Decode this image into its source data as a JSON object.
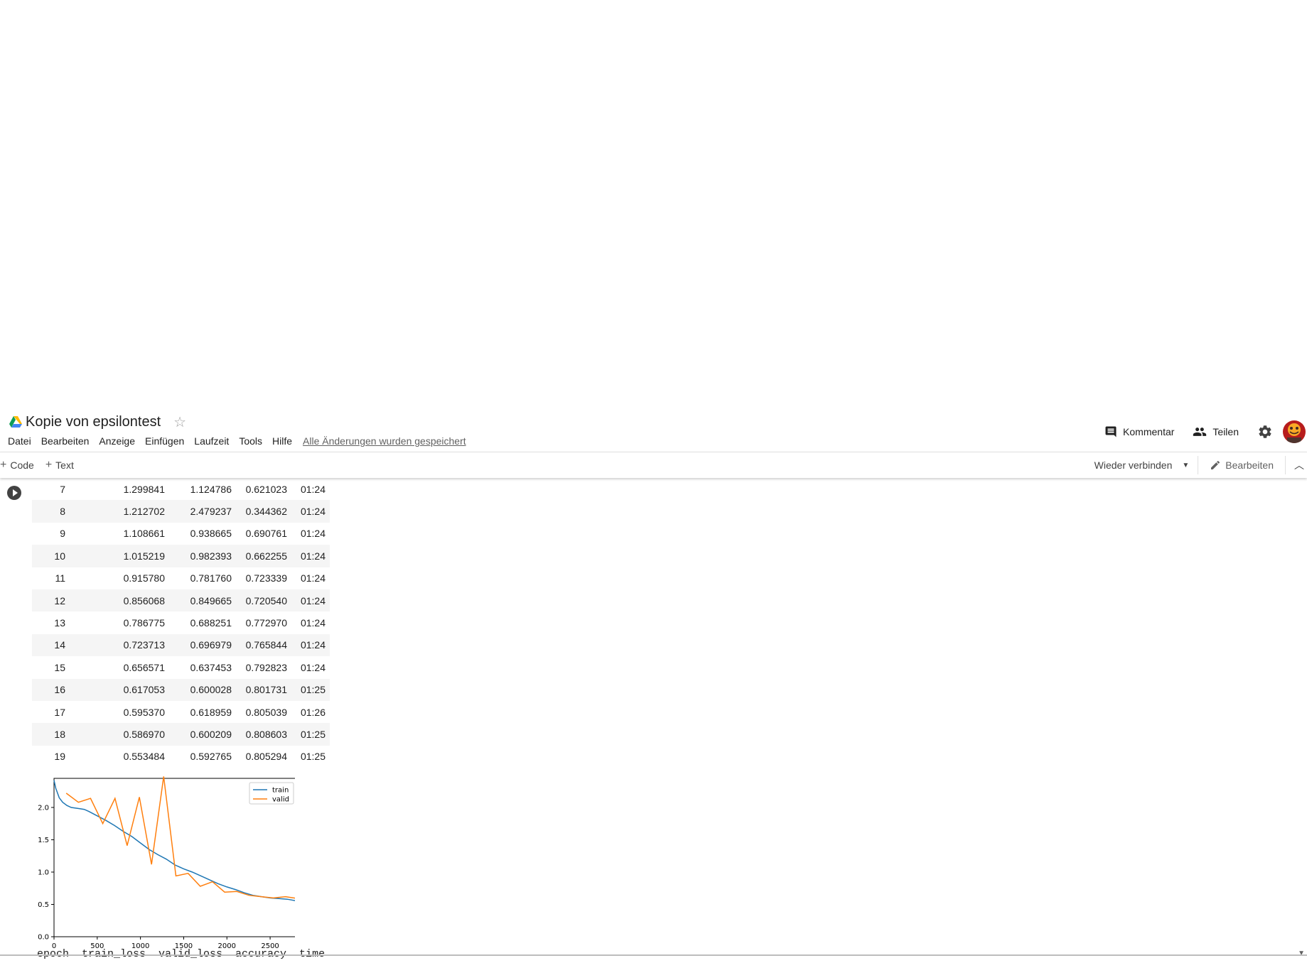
{
  "header": {
    "title": "Kopie von epsilontest",
    "icons": {
      "drive": "google-drive-icon",
      "star": "star-outline-icon"
    },
    "menu": [
      "Datei",
      "Bearbeiten",
      "Anzeige",
      "Einfügen",
      "Laufzeit",
      "Tools",
      "Hilfe"
    ],
    "saved_status": "Alle Änderungen wurden gespeichert",
    "comment_label": "Kommentar",
    "share_label": "Teilen"
  },
  "toolbar": {
    "add_code": "Code",
    "add_text": "Text",
    "plus": "+",
    "reconnect": "Wieder verbinden",
    "edit": "Bearbeiten"
  },
  "results": {
    "rows": [
      [
        "7",
        "1.299841",
        "1.124786",
        "0.621023",
        "01:24"
      ],
      [
        "8",
        "1.212702",
        "2.479237",
        "0.344362",
        "01:24"
      ],
      [
        "9",
        "1.108661",
        "0.938665",
        "0.690761",
        "01:24"
      ],
      [
        "10",
        "1.015219",
        "0.982393",
        "0.662255",
        "01:24"
      ],
      [
        "11",
        "0.915780",
        "0.781760",
        "0.723339",
        "01:24"
      ],
      [
        "12",
        "0.856068",
        "0.849665",
        "0.720540",
        "01:24"
      ],
      [
        "13",
        "0.786775",
        "0.688251",
        "0.772970",
        "01:24"
      ],
      [
        "14",
        "0.723713",
        "0.696979",
        "0.765844",
        "01:24"
      ],
      [
        "15",
        "0.656571",
        "0.637453",
        "0.792823",
        "01:24"
      ],
      [
        "16",
        "0.617053",
        "0.600028",
        "0.801731",
        "01:25"
      ],
      [
        "17",
        "0.595370",
        "0.618959",
        "0.805039",
        "01:26"
      ],
      [
        "18",
        "0.586970",
        "0.600209",
        "0.808603",
        "01:25"
      ],
      [
        "19",
        "0.553484",
        "0.592765",
        "0.805294",
        "01:25"
      ]
    ]
  },
  "next_output_header": "epoch  train_loss  valid_loss  accuracy  time",
  "colors": {
    "train": "#1f77b4",
    "valid": "#ff7f0e"
  },
  "chart_data": {
    "type": "line",
    "xlim": [
      0,
      2820
    ],
    "ylim": [
      0,
      2.45
    ],
    "xticks": [
      0,
      500,
      1000,
      1500,
      2000,
      2500
    ],
    "yticks": [
      0.0,
      0.5,
      1.0,
      1.5,
      2.0
    ],
    "legend": "top-right",
    "series": [
      {
        "name": "train",
        "x": [
          0,
          20,
          60,
          100,
          150,
          200,
          250,
          300,
          350,
          400,
          500,
          600,
          700,
          800,
          900,
          1000,
          1100,
          1200,
          1300,
          1400,
          1500,
          1600,
          1700,
          1800,
          1900,
          2000,
          2100,
          2200,
          2300,
          2400,
          2500,
          2600,
          2700,
          2820
        ],
        "y": [
          2.42,
          2.3,
          2.15,
          2.08,
          2.03,
          2.0,
          1.99,
          1.98,
          1.97,
          1.94,
          1.87,
          1.8,
          1.72,
          1.63,
          1.55,
          1.45,
          1.35,
          1.27,
          1.2,
          1.11,
          1.05,
          1.0,
          0.94,
          0.88,
          0.82,
          0.77,
          0.73,
          0.68,
          0.64,
          0.62,
          0.6,
          0.59,
          0.58,
          0.55
        ]
      },
      {
        "name": "valid",
        "x": [
          141,
          282,
          423,
          564,
          705,
          846,
          987,
          1128,
          1269,
          1410,
          1551,
          1692,
          1833,
          1974,
          2115,
          2256,
          2397,
          2538,
          2679,
          2820
        ],
        "y": [
          2.22,
          2.08,
          2.14,
          1.75,
          2.14,
          1.41,
          2.16,
          1.12,
          2.48,
          0.94,
          0.98,
          0.78,
          0.85,
          0.69,
          0.7,
          0.64,
          0.62,
          0.6,
          0.62,
          0.59
        ]
      }
    ]
  }
}
